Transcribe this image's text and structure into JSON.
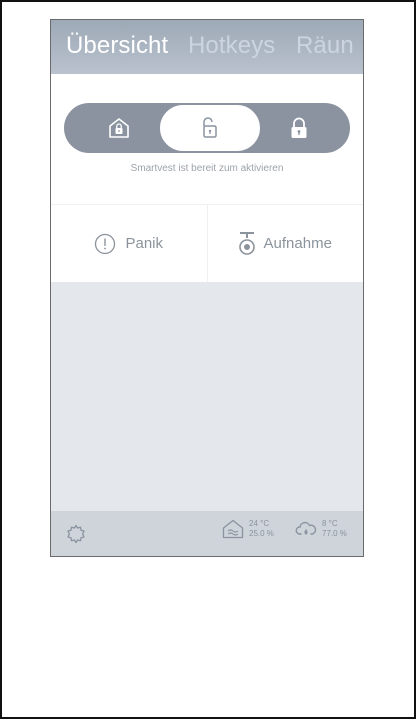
{
  "header": {
    "tabs": [
      {
        "label": "Übersicht",
        "active": true
      },
      {
        "label": "Hotkeys",
        "active": false
      },
      {
        "label": "Räun",
        "active": false
      }
    ]
  },
  "mode_selector": {
    "modes": [
      {
        "icon": "home-lock-icon",
        "selected": false
      },
      {
        "icon": "unlock-icon",
        "selected": true
      },
      {
        "icon": "lock-icon",
        "selected": false
      }
    ],
    "status": "Smartvest ist bereit zum aktivieren"
  },
  "hotkeys": {
    "panic_label": "Panik",
    "record_label": "Aufnahme"
  },
  "footer": {
    "indoor": {
      "temperature": "24 °C",
      "humidity": "25.0 %"
    },
    "outdoor": {
      "temperature": "8 °C",
      "humidity": "77.0 %"
    }
  },
  "colors": {
    "header": "#a9b3bf",
    "pill": "#8a939f",
    "content_background": "#e4e7ec",
    "footer": "#cfd4da",
    "icon": "#8a939f"
  }
}
